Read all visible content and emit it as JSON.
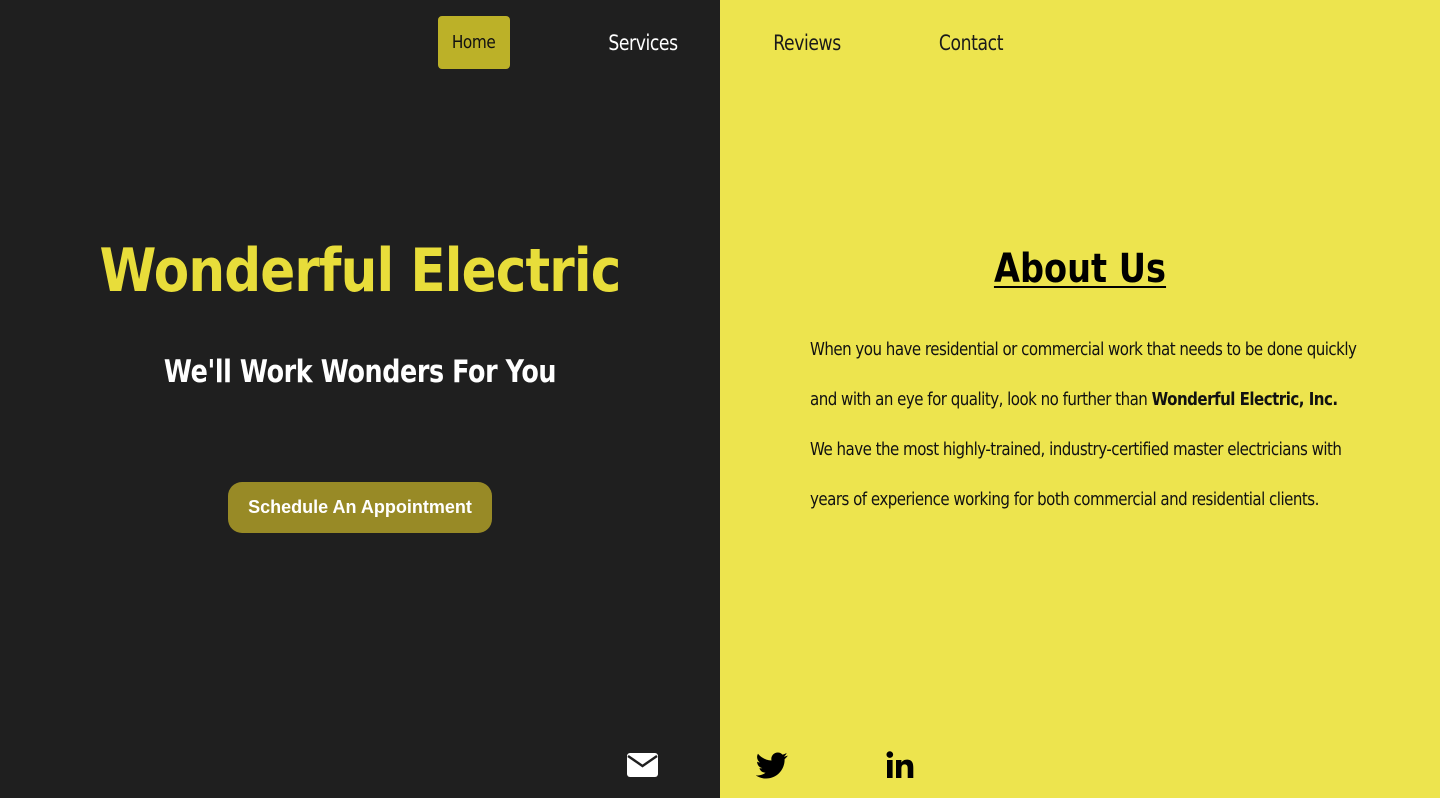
{
  "nav": {
    "items": [
      {
        "label": "Home",
        "active": true
      },
      {
        "label": "Services",
        "active": false
      },
      {
        "label": "Reviews",
        "active": false
      },
      {
        "label": "Contact",
        "active": false
      }
    ]
  },
  "hero": {
    "title": "Wonderful Electric",
    "tagline": "We'll Work Wonders For You",
    "cta_label": "Schedule An Appointment"
  },
  "about": {
    "heading": "About Us",
    "text_part1": "When you have residential or commercial work that needs to be done quickly and with an eye for quality, look no further than ",
    "company_name": "Wonderful Electric, Inc.",
    "text_part2": " We have the most highly-trained, industry-certified master electricians with years of experience working for both commercial and residential clients."
  },
  "social": {
    "icons": [
      "envelope-icon",
      "twitter-icon",
      "linkedin-icon"
    ]
  },
  "colors": {
    "dark_bg": "#1f1f1f",
    "yellow_bg": "#ede44e",
    "brand_yellow": "#e8dd3a",
    "nav_active": "#bcb128",
    "cta_bg": "#988a26"
  }
}
